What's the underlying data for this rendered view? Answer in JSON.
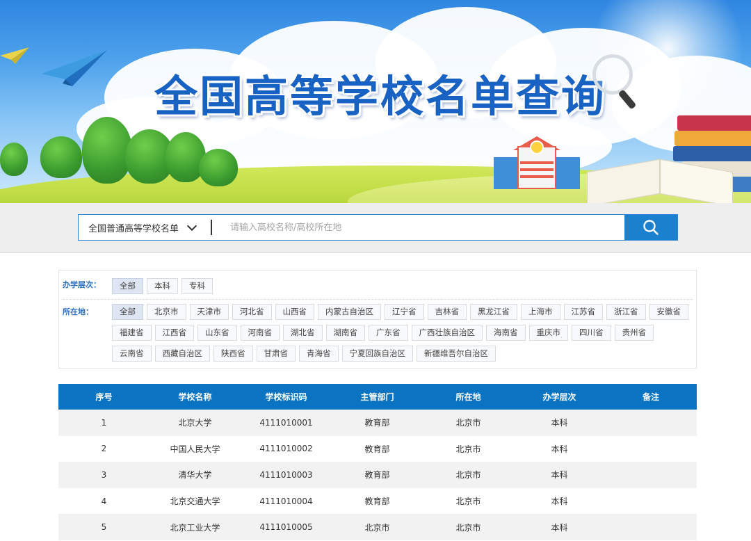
{
  "banner": {
    "title": "全国高等学校名单查询"
  },
  "search": {
    "category_selected": "全国普通高等学校名单",
    "placeholder": "请输入高校名称/高校所在地",
    "value": ""
  },
  "filters": {
    "level_label": "办学层次：",
    "levels": [
      {
        "label": "全部",
        "active": true
      },
      {
        "label": "本科",
        "active": false
      },
      {
        "label": "专科",
        "active": false
      }
    ],
    "location_label": "所在地：",
    "locations": [
      {
        "label": "全部",
        "active": true
      },
      {
        "label": "北京市",
        "active": false
      },
      {
        "label": "天津市",
        "active": false
      },
      {
        "label": "河北省",
        "active": false
      },
      {
        "label": "山西省",
        "active": false
      },
      {
        "label": "内蒙古自治区",
        "active": false
      },
      {
        "label": "辽宁省",
        "active": false
      },
      {
        "label": "吉林省",
        "active": false
      },
      {
        "label": "黑龙江省",
        "active": false
      },
      {
        "label": "上海市",
        "active": false
      },
      {
        "label": "江苏省",
        "active": false
      },
      {
        "label": "浙江省",
        "active": false
      },
      {
        "label": "安徽省",
        "active": false
      },
      {
        "label": "福建省",
        "active": false
      },
      {
        "label": "江西省",
        "active": false
      },
      {
        "label": "山东省",
        "active": false
      },
      {
        "label": "河南省",
        "active": false
      },
      {
        "label": "湖北省",
        "active": false
      },
      {
        "label": "湖南省",
        "active": false
      },
      {
        "label": "广东省",
        "active": false
      },
      {
        "label": "广西壮族自治区",
        "active": false
      },
      {
        "label": "海南省",
        "active": false
      },
      {
        "label": "重庆市",
        "active": false
      },
      {
        "label": "四川省",
        "active": false
      },
      {
        "label": "贵州省",
        "active": false
      },
      {
        "label": "云南省",
        "active": false
      },
      {
        "label": "西藏自治区",
        "active": false
      },
      {
        "label": "陕西省",
        "active": false
      },
      {
        "label": "甘肃省",
        "active": false
      },
      {
        "label": "青海省",
        "active": false
      },
      {
        "label": "宁夏回族自治区",
        "active": false
      },
      {
        "label": "新疆维吾尔自治区",
        "active": false
      }
    ]
  },
  "table": {
    "headers": [
      "序号",
      "学校名称",
      "学校标识码",
      "主管部门",
      "所在地",
      "办学层次",
      "备注"
    ],
    "rows": [
      [
        "1",
        "北京大学",
        "4111010001",
        "教育部",
        "北京市",
        "本科",
        ""
      ],
      [
        "2",
        "中国人民大学",
        "4111010002",
        "教育部",
        "北京市",
        "本科",
        ""
      ],
      [
        "3",
        "清华大学",
        "4111010003",
        "教育部",
        "北京市",
        "本科",
        ""
      ],
      [
        "4",
        "北京交通大学",
        "4111010004",
        "教育部",
        "北京市",
        "本科",
        ""
      ],
      [
        "5",
        "北京工业大学",
        "4111010005",
        "北京市",
        "北京市",
        "本科",
        ""
      ]
    ]
  },
  "colors": {
    "accent": "#1b80cd",
    "header_bg": "#0b74c2",
    "filter_label": "#2a6fc4",
    "title": "#1862c4"
  },
  "icons": {
    "search_button": "search-icon",
    "dropdown": "chevron-down-icon"
  }
}
